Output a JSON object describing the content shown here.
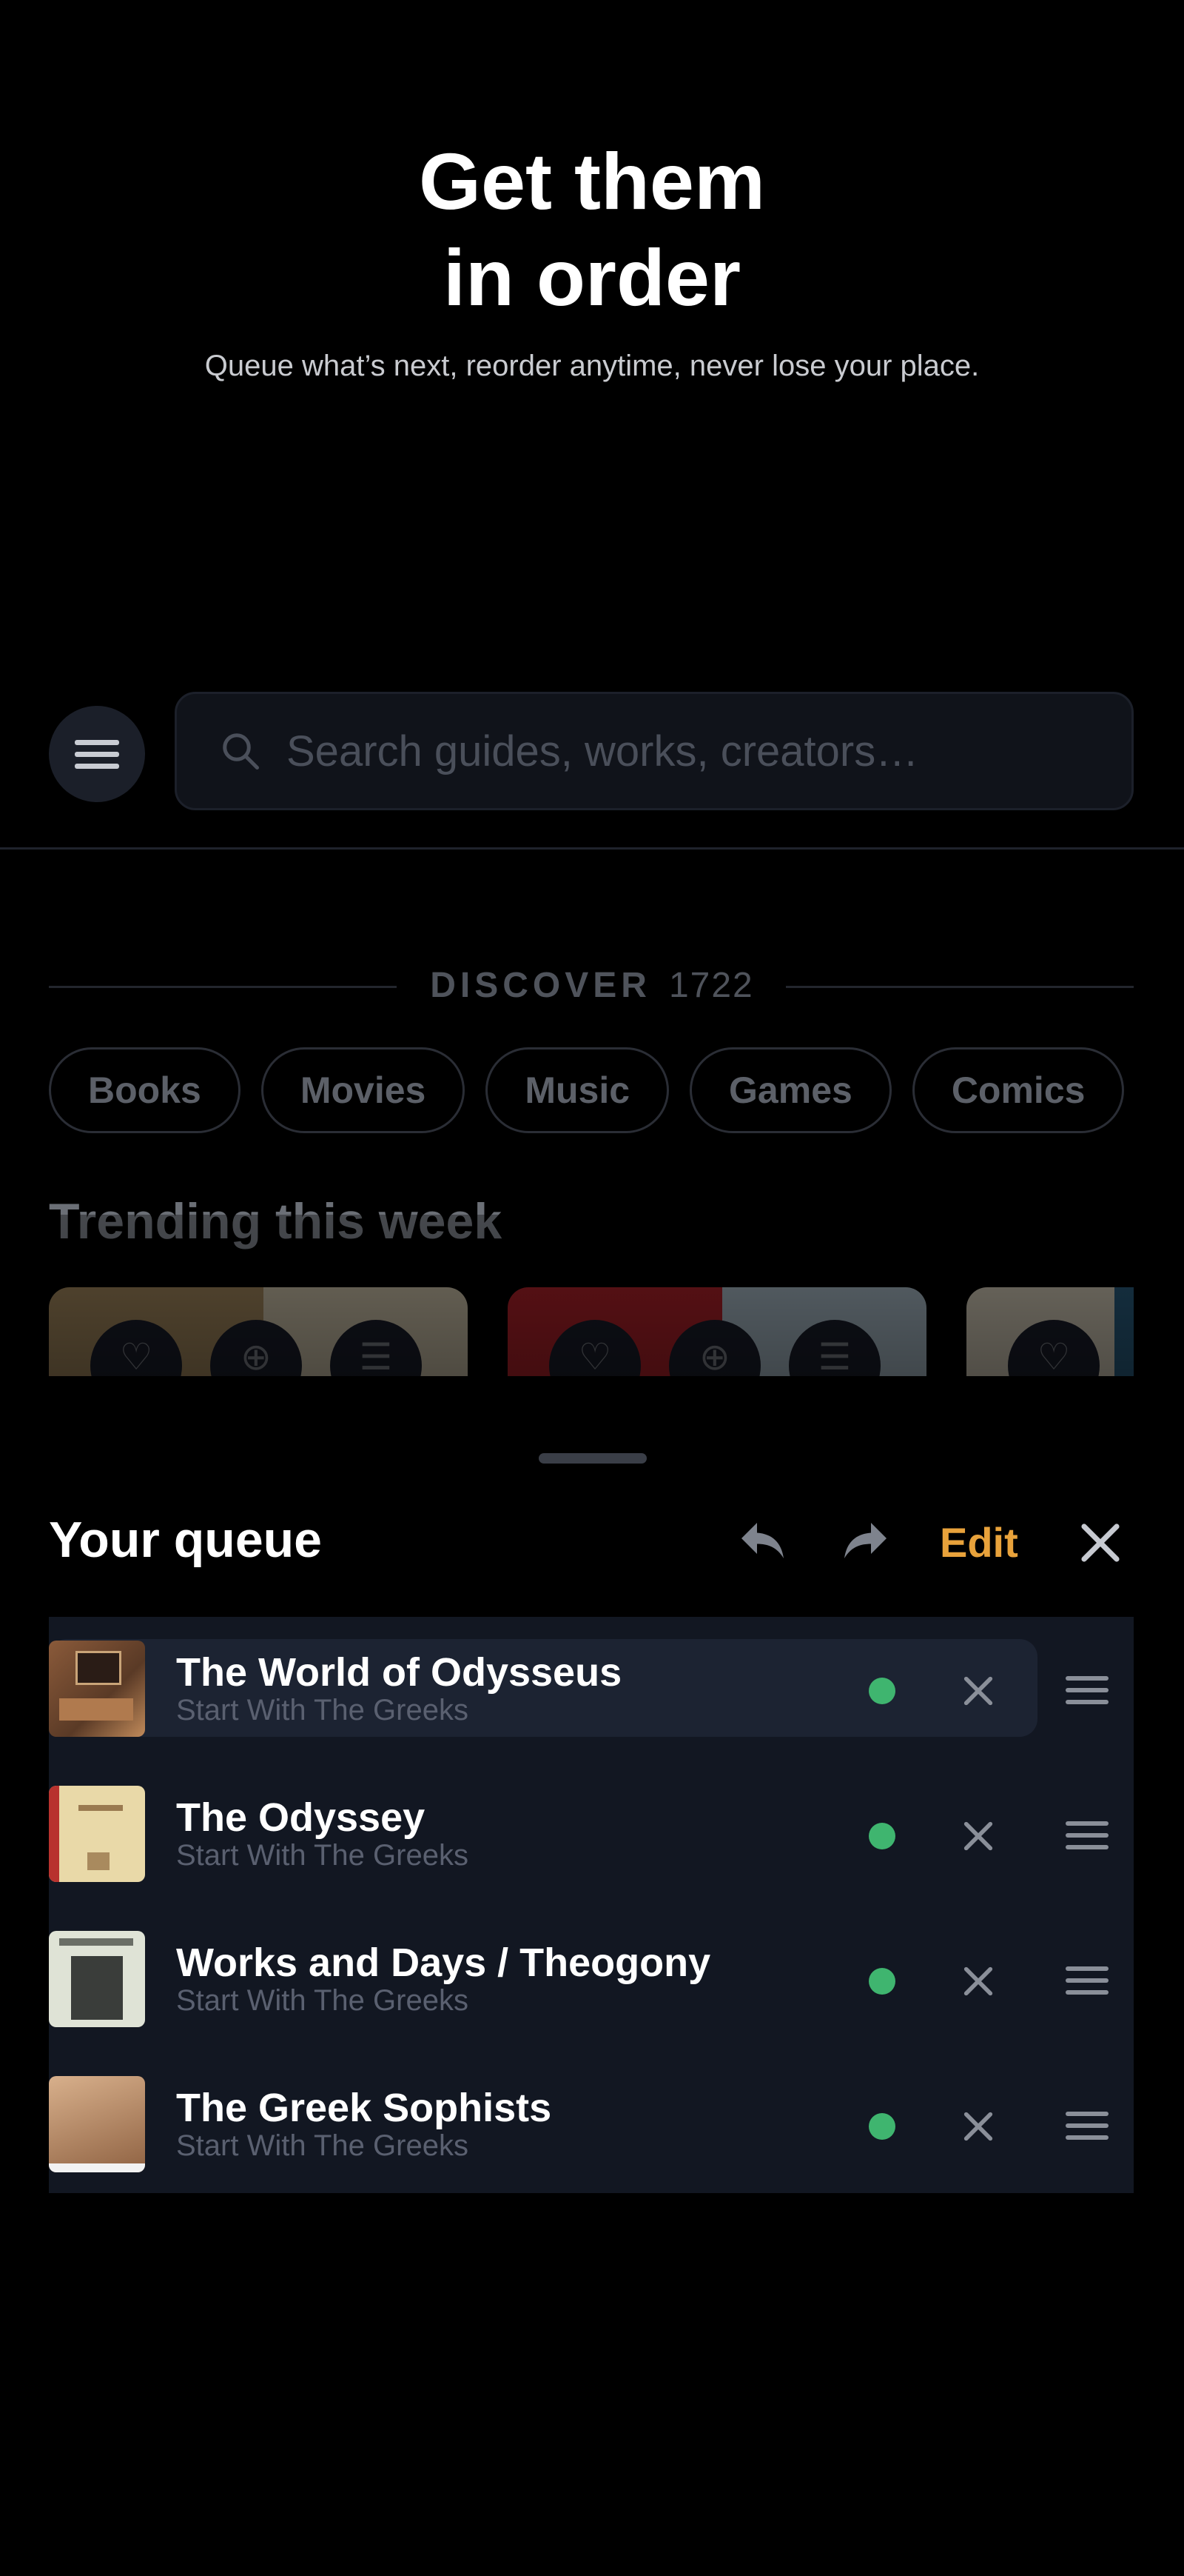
{
  "hero": {
    "title_line1": "Get them",
    "title_line2": "in order",
    "subtitle": "Queue what’s next, reorder anytime, never lose your place."
  },
  "search": {
    "placeholder": "Search guides, works, creators…",
    "menu_icon": "hamburger-menu-icon",
    "search_icon": "magnifier-icon"
  },
  "discover": {
    "label": "DISCOVER",
    "count": "1722",
    "chips": [
      "Books",
      "Movies",
      "Music",
      "Games",
      "Comics"
    ]
  },
  "trending": {
    "title": "Trending this week",
    "cards": [
      {
        "colors": [
          "#b89a6a",
          "#e8dcc0"
        ]
      },
      {
        "colors": [
          "#c7262f",
          "#bfd3e0"
        ]
      },
      {
        "colors": [
          "#efe6d0",
          "#2f6a8f"
        ]
      }
    ]
  },
  "queue": {
    "title": "Your queue",
    "edit_label": "Edit",
    "undo_icon": "undo-icon",
    "redo_icon": "redo-icon",
    "close_icon": "close-icon",
    "accent_color": "#e8a23b",
    "status_color": "#3fb56f",
    "items": [
      {
        "title": "The World of Odysseus",
        "subtitle": "Start With The Greeks",
        "active": true
      },
      {
        "title": "The Odyssey",
        "subtitle": "Start With The Greeks",
        "active": false
      },
      {
        "title": "Works and Days / Theogony",
        "subtitle": "Start With The Greeks",
        "active": false
      },
      {
        "title": "The Greek Sophists",
        "subtitle": "Start With The Greeks",
        "active": false
      }
    ]
  }
}
